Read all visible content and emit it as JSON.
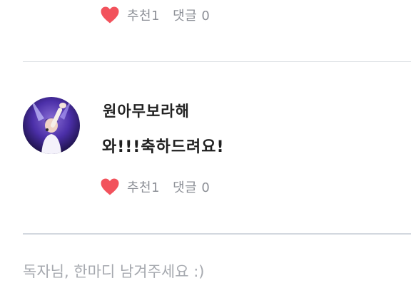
{
  "previous_comment": {
    "recommend_label": "추천1",
    "comment_count_label": "댓글 0"
  },
  "comment": {
    "username": "원아무보라해",
    "text": "와!!!축하드려요!",
    "recommend_label": "추천1",
    "comment_count_label": "댓글 0"
  },
  "reply": {
    "placeholder": "독자님, 한마디 남겨주세요 :)"
  },
  "colors": {
    "heart": "#f2525c",
    "meta_text": "#8c8f96",
    "divider": "#dcdfe4",
    "placeholder": "#a6a9af"
  },
  "icons": {
    "like": "heart-icon",
    "avatar": "user-avatar-photo"
  }
}
